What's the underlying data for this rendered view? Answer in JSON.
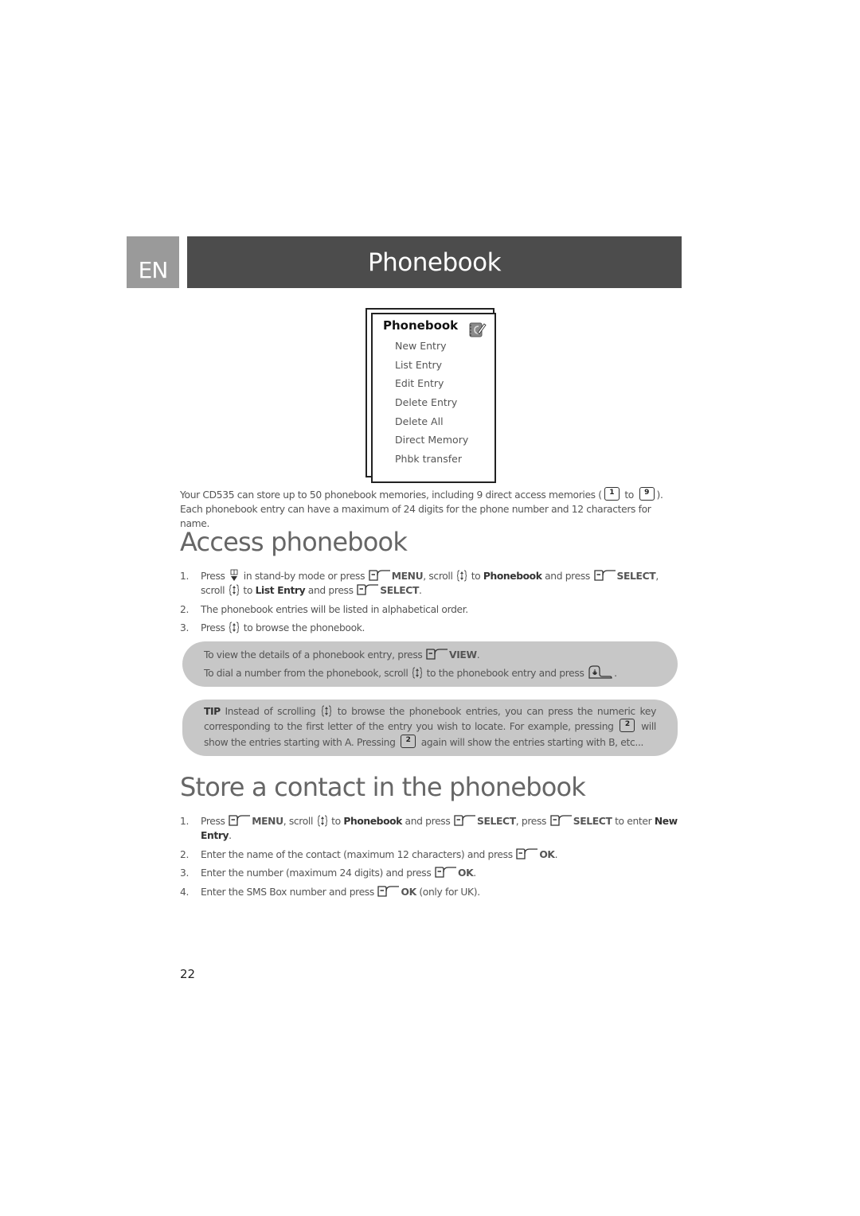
{
  "header": {
    "language": "EN",
    "title": "Phonebook"
  },
  "phone_menu": {
    "title": "Phonebook",
    "icon": "phonebook-icon",
    "items": [
      "New Entry",
      "List Entry",
      "Edit Entry",
      "Delete Entry",
      "Delete All",
      "Direct Memory",
      "Phbk transfer"
    ]
  },
  "intro": {
    "line1_before": "Your CD535 can store up to 50 phonebook memories, including 9 direct access memories (",
    "key_from": "1",
    "to_word": "to",
    "key_to": "9",
    "line1_after": ").",
    "line2": "Each phonebook entry can have a maximum of 24 digits for the phone number and 12 characters for name."
  },
  "access": {
    "heading": "Access phonebook",
    "steps": [
      {
        "num": "1.",
        "t1": "Press",
        "t2": "in stand-by mode or press",
        "menu": "MENU",
        "t3": ", scroll",
        "t4": "to",
        "phonebook": "Phonebook",
        "t5": "and press",
        "select1": "SELECT",
        "t6": ", scroll",
        "t7": "to",
        "list_entry": "List Entry",
        "t8": "and press",
        "select2": "SELECT",
        "t9": "."
      },
      {
        "num": "2.",
        "text": "The phonebook entries will be listed in alphabetical order."
      },
      {
        "num": "3.",
        "t1": "Press",
        "t2": "to browse the phonebook."
      }
    ]
  },
  "note_view": {
    "line1_before": "To view the details of a phonebook entry, press",
    "view": "VIEW",
    "line1_after": ".",
    "line2_before": "To dial a number from the phonebook, scroll",
    "line2_mid": "to the phonebook entry and press",
    "line2_after": "."
  },
  "tip": {
    "label": "TIP",
    "t1": "Instead of scrolling",
    "t2": "to browse the phonebook entries, you can press the numeric key corresponding to the first letter of the entry you wish to locate. For example, pressing",
    "key": "2",
    "t3": "will show the entries starting with A. Pressing",
    "t4": "again will show the entries starting with B, etc..."
  },
  "store": {
    "heading": "Store a contact in the phonebook",
    "steps": [
      {
        "num": "1.",
        "t1": "Press",
        "menu": "MENU",
        "t2": ", scroll",
        "t3": "to",
        "phonebook": "Phonebook",
        "t4": "and press",
        "select1": "SELECT",
        "t5": ", press",
        "select2": "SELECT",
        "t6": "to enter",
        "new_entry": "New Entry",
        "t7": "."
      },
      {
        "num": "2.",
        "t1": "Enter the name of the contact (maximum 12 characters) and press",
        "ok": "OK",
        "t2": "."
      },
      {
        "num": "3.",
        "t1": "Enter the number (maximum 24 digits) and press",
        "ok": "OK",
        "t2": "."
      },
      {
        "num": "4.",
        "t1": "Enter the SMS Box number and press",
        "ok": "OK",
        "t2": "(only for UK)."
      }
    ]
  },
  "page_number": "22"
}
